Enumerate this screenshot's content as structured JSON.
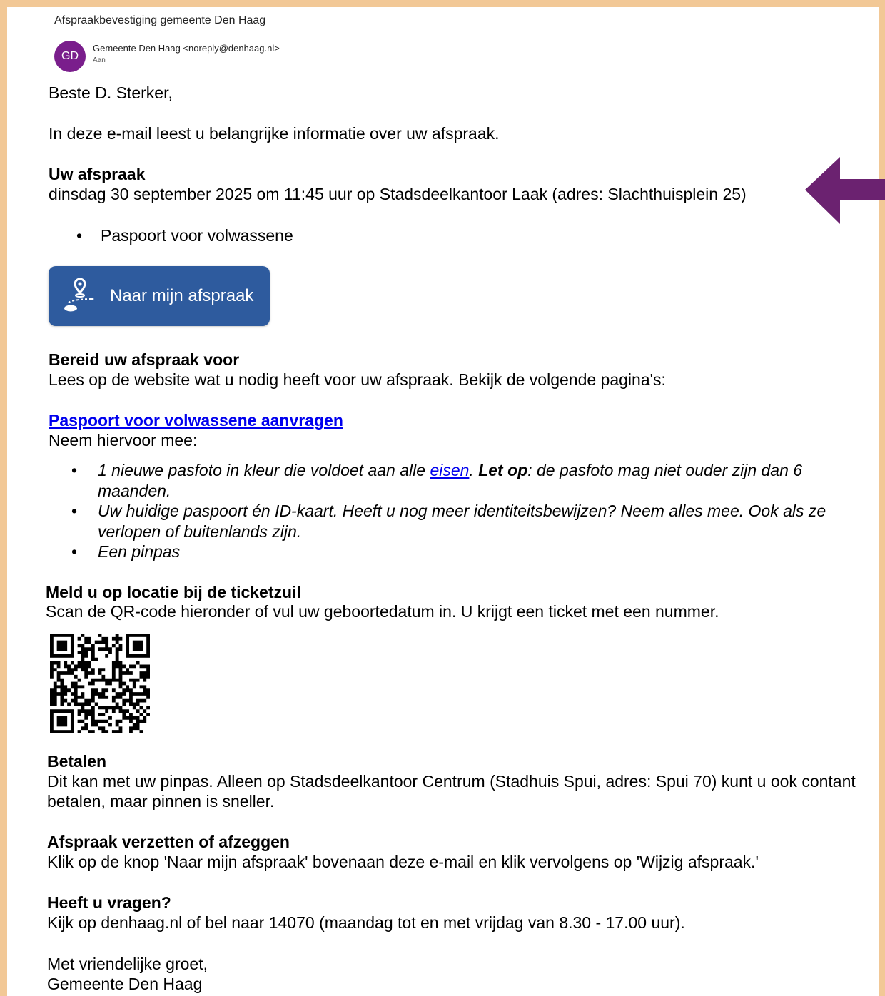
{
  "email": {
    "subject": "Afspraakbevestiging gemeente Den Haag",
    "avatar_initials": "GD",
    "sender": "Gemeente Den Haag <noreply@denhaag.nl>",
    "to_label": "Aan"
  },
  "body": {
    "greeting": "Beste D. Sterker,",
    "intro": "In deze e-mail leest u belangrijke informatie over uw afspraak.",
    "appointment": {
      "heading": "Uw afspraak",
      "details": "dinsdag 30 september 2025 om 11:45 uur op Stadsdeelkantoor Laak (adres: Slachthuisplein 25)",
      "items": [
        "Paspoort voor volwassene"
      ]
    },
    "button": {
      "label": "Naar mijn afspraak",
      "icon": "map-route-icon",
      "color": "#2e5b9e"
    },
    "prepare": {
      "heading": "Bereid uw afspraak voor",
      "text": "Lees op de website wat u nodig heeft voor uw afspraak. Bekijk de volgende pagina's:",
      "link": "Paspoort voor volwassene aanvragen",
      "bring_label": "Neem hiervoor mee:",
      "bullets": {
        "photo_pre": "1 nieuwe pasfoto in kleur die voldoet aan alle ",
        "photo_link": "eisen",
        "photo_dot": ".",
        "photo_bold": " Let op",
        "photo_post": ": de pasfoto mag niet ouder zijn dan 6 maanden.",
        "id": "Uw huidige paspoort én ID-kaart. Heeft u nog meer identiteitsbewijzen? Neem alles mee. Ook als ze verlopen of buitenlands zijn.",
        "pin": "Een pinpas"
      }
    },
    "checkin": {
      "heading": "Meld u op locatie bij de ticketzuil",
      "text": "Scan de QR-code hieronder of vul uw geboortedatum in. U krijgt een ticket met een nummer."
    },
    "payment": {
      "heading": "Betalen",
      "text": "Dit kan met uw pinpas. Alleen op Stadsdeelkantoor Centrum (Stadhuis Spui, adres: Spui 70) kunt u ook contant betalen, maar pinnen is sneller."
    },
    "reschedule": {
      "heading": "Afspraak verzetten of afzeggen",
      "text": "Klik op de knop 'Naar mijn afspraak' bovenaan deze e-mail en klik vervolgens op 'Wijzig afspraak.'"
    },
    "questions": {
      "heading": "Heeft u vragen?",
      "text": "Kijk op denhaag.nl of bel naar 14070 (maandag tot en met vrijdag van 8.30 - 17.00 uur)."
    },
    "closing": "Met vriendelijke groet,",
    "signature": "Gemeente Den Haag"
  },
  "colors": {
    "frame": "#f2c896",
    "avatar": "#7a1e8c",
    "arrow": "#6b2270",
    "link": "#0000ee"
  }
}
